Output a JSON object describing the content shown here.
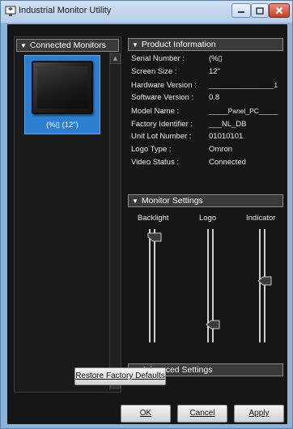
{
  "window": {
    "title": "Industrial Monitor Utility",
    "icon": "monitor-app-icon",
    "controls": [
      "minimize-icon",
      "maximize-icon",
      "close-icon"
    ]
  },
  "left_panel": {
    "header": "Connected Monitors",
    "items": [
      {
        "label": "(%▯ (12\")",
        "selected": true
      }
    ]
  },
  "product_information": {
    "header": "Product Information",
    "fields": [
      {
        "label": "Serial Number :",
        "value": "(%▯"
      },
      {
        "label": "Screen Size :",
        "value": "12\""
      },
      {
        "label": "Hardware Version :",
        "value": "_________________1"
      },
      {
        "label": "Software Version :",
        "value": "0.8"
      },
      {
        "label": "Model Name :",
        "value": "_____Panel_PC_____"
      },
      {
        "label": "Factory Identifier :",
        "value": "___NL_DB"
      },
      {
        "label": "Unit Lot Number :",
        "value": "01010101"
      },
      {
        "label": "Logo Type :",
        "value": "Omron"
      },
      {
        "label": "Video Status :",
        "value": "Connected"
      }
    ]
  },
  "monitor_settings": {
    "header": "Monitor Settings",
    "sliders": [
      {
        "label": "Backlight",
        "level": 1.0
      },
      {
        "label": "Logo",
        "level": 0.0
      },
      {
        "label": "Indicator",
        "level": 0.5
      }
    ]
  },
  "advanced_settings": {
    "header": "Advanced Settings",
    "restore_label": "Restore Factory Defaults"
  },
  "footer": {
    "ok_label": "OK",
    "cancel_label": "Cancel",
    "apply_label": "Apply"
  },
  "colors": {
    "window_frame": "#8bb3d8",
    "panel_background": "#151515",
    "selection": "#2c7fd0",
    "close_button": "#c2412c"
  }
}
